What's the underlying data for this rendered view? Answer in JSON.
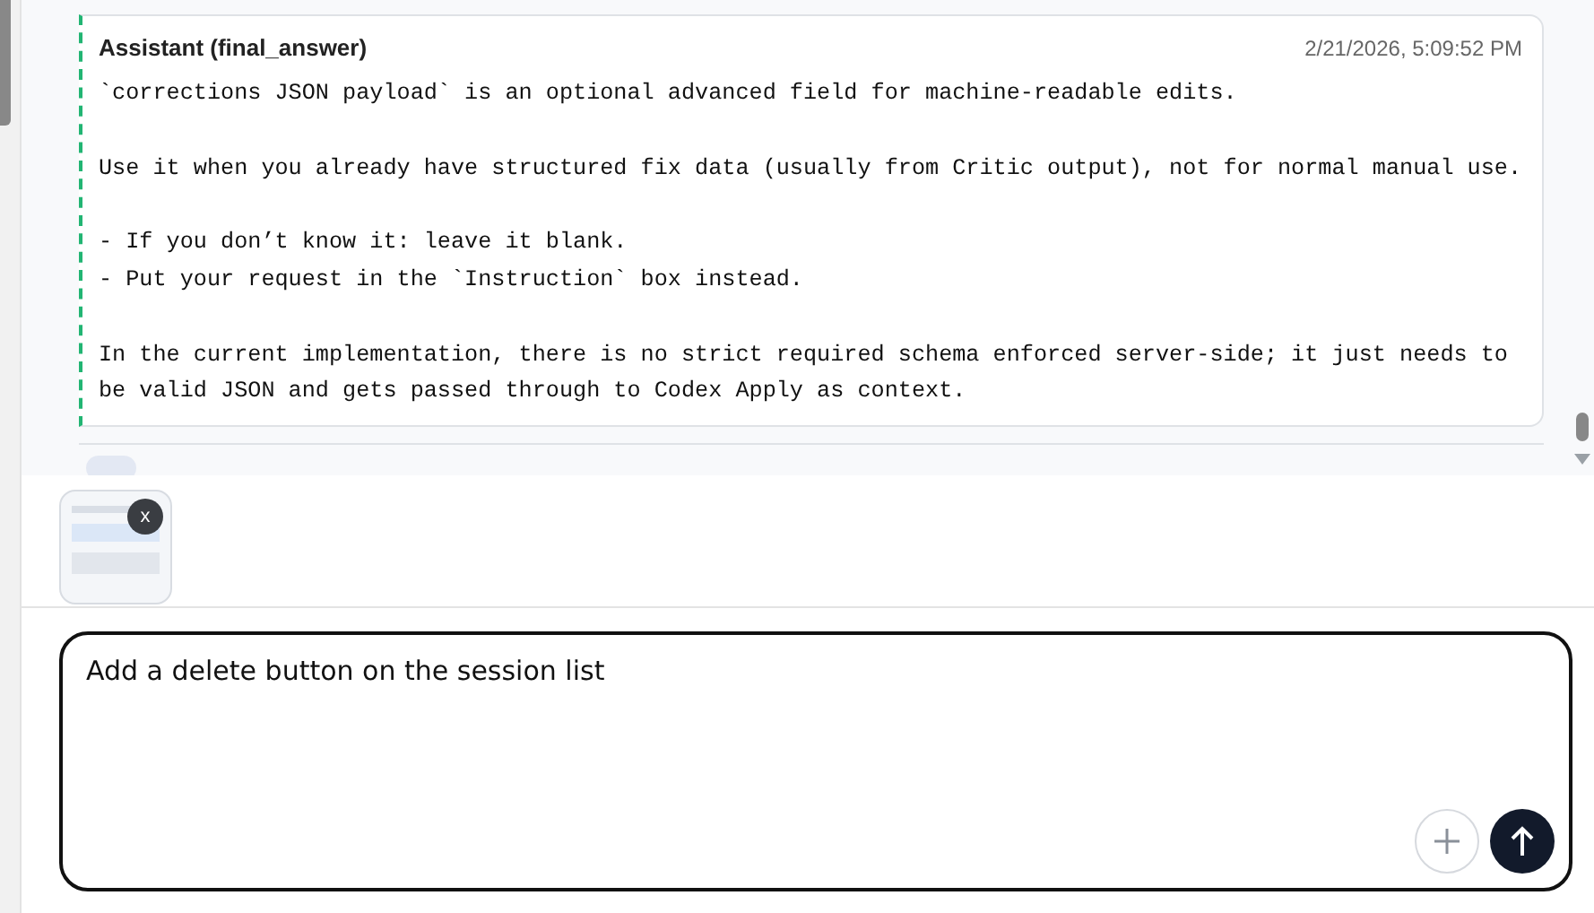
{
  "message": {
    "author": "Assistant (final_answer)",
    "time": "2/21/2026, 5:09:52 PM",
    "blocks": [
      [
        "`corrections JSON payload` is an optional advanced field for machine-readable edits."
      ],
      [
        "Use it when you already have structured fix data (usually from Critic output), not for normal manual use."
      ],
      [
        "- If you don’t know it: leave it blank.",
        "- Put your request in the `Instruction` box instead."
      ],
      [
        "In the current implementation, there is no strict required schema enforced server-side; it just needs to be valid JSON and gets passed through to Codex Apply as context."
      ]
    ]
  },
  "attachment": {
    "remove_label": "x"
  },
  "composer": {
    "value": "Add a delete button on the session list"
  }
}
